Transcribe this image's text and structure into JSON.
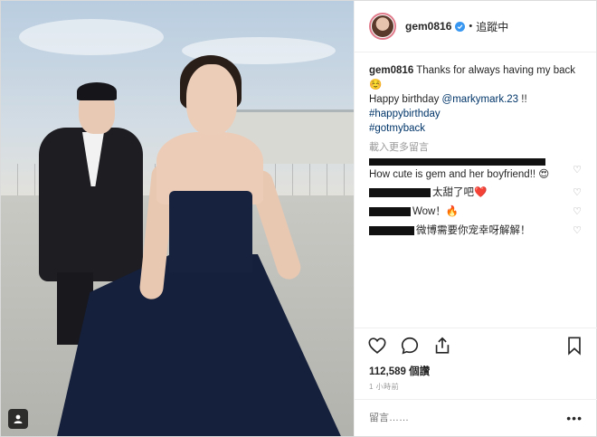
{
  "header": {
    "username": "gem0816",
    "dot": "•",
    "follow_label": "追蹤中"
  },
  "caption": {
    "username": "gem0816",
    "line1": "Thanks for always having my back",
    "emoji": "☺️",
    "line2_prefix": "Happy birthday ",
    "mention": "@markymark.23",
    "line2_suffix": " !!",
    "hashtag1": "#happybirthday",
    "hashtag2": "#gotmyback"
  },
  "load_more": "載入更多留言",
  "comments": [
    {
      "text": "How cute is gem and her boyfriend!! 😍"
    },
    {
      "text": "太甜了吧❤️"
    },
    {
      "text": "Wow！🔥"
    },
    {
      "text": "微博需要你宠幸呀解解！"
    }
  ],
  "likes": "112,589 個讚",
  "time": "1 小時前",
  "comment_placeholder": "留言……",
  "more_label": "•••",
  "icons": {
    "like": "heart-icon",
    "comment": "comment-icon",
    "share": "share-icon",
    "save": "bookmark-icon",
    "verified": "verified-badge-icon",
    "tagged": "user-tag-icon"
  }
}
